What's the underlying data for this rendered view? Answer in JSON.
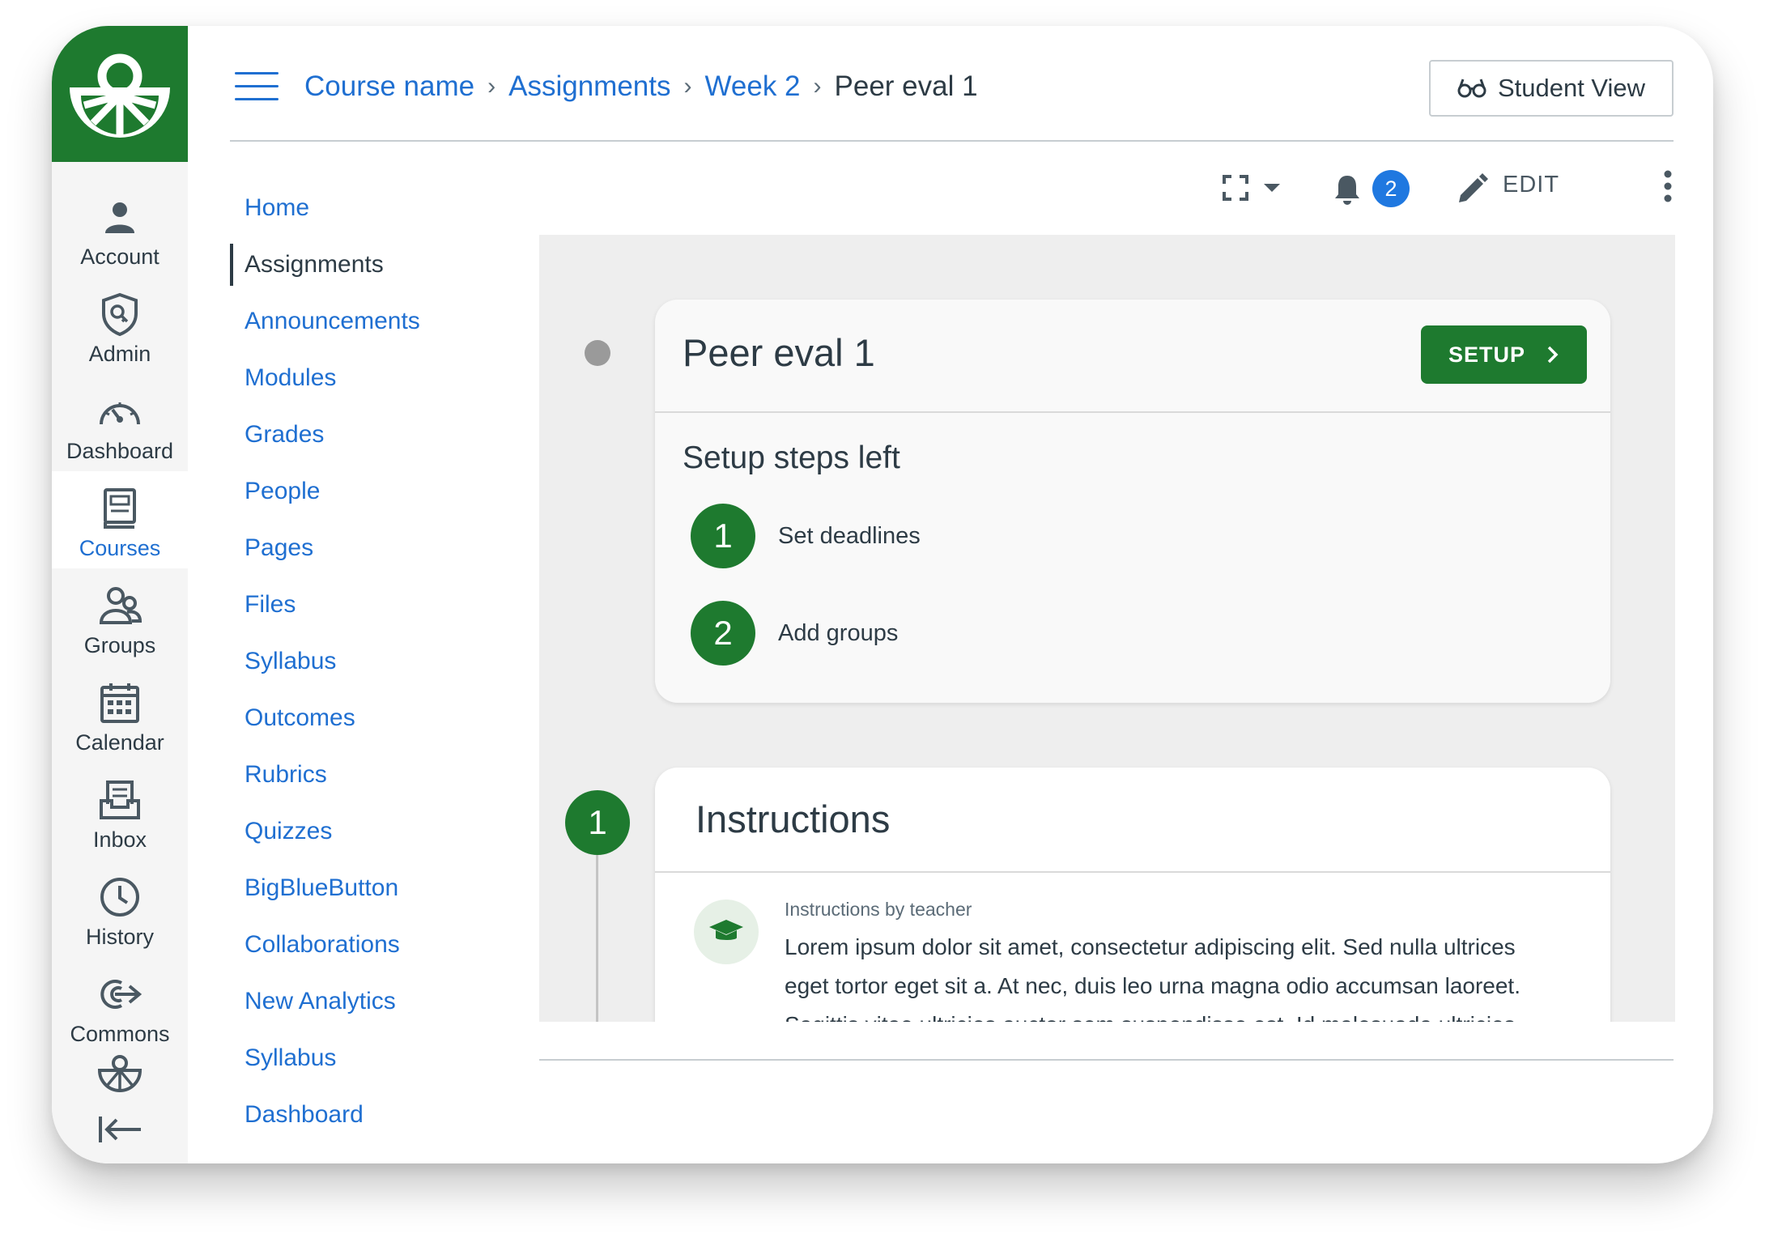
{
  "global_nav": {
    "items": [
      {
        "label": "Account",
        "icon": "account-icon"
      },
      {
        "label": "Admin",
        "icon": "admin-shield-icon"
      },
      {
        "label": "Dashboard",
        "icon": "dashboard-gauge-icon"
      },
      {
        "label": "Courses",
        "icon": "courses-book-icon",
        "active": true
      },
      {
        "label": "Groups",
        "icon": "groups-icon"
      },
      {
        "label": "Calendar",
        "icon": "calendar-icon"
      },
      {
        "label": "Inbox",
        "icon": "inbox-icon"
      },
      {
        "label": "History",
        "icon": "history-clock-icon"
      },
      {
        "label": "Commons",
        "icon": "commons-icon"
      }
    ]
  },
  "header": {
    "breadcrumbs": [
      "Course name",
      "Assignments",
      "Week 2"
    ],
    "current": "Peer eval 1",
    "student_view_label": "Student View"
  },
  "course_nav": {
    "items": [
      {
        "label": "Home"
      },
      {
        "label": "Assignments",
        "active": true
      },
      {
        "label": "Announcements"
      },
      {
        "label": "Modules"
      },
      {
        "label": "Grades"
      },
      {
        "label": "People"
      },
      {
        "label": "Pages"
      },
      {
        "label": "Files"
      },
      {
        "label": "Syllabus"
      },
      {
        "label": "Outcomes"
      },
      {
        "label": "Rubrics"
      },
      {
        "label": "Quizzes"
      },
      {
        "label": "BigBlueButton"
      },
      {
        "label": "Collaborations"
      },
      {
        "label": "New Analytics"
      },
      {
        "label": "Syllabus"
      },
      {
        "label": "Dashboard"
      }
    ]
  },
  "toolbar": {
    "notification_count": "2",
    "edit_label": "EDIT"
  },
  "assignment_card": {
    "title": "Peer eval 1",
    "setup_label": "SETUP",
    "steps_title": "Setup steps left",
    "steps": [
      {
        "num": "1",
        "label": "Set deadlines"
      },
      {
        "num": "2",
        "label": "Add groups"
      }
    ]
  },
  "instructions_card": {
    "step_num": "1",
    "title": "Instructions",
    "by_label": "Instructions by teacher",
    "text": "Lorem ipsum dolor sit amet, consectetur adipiscing elit. Sed nulla ultrices eget tortor eget sit a. At nec, duis leo urna magna odio accumsan laoreet. Sagittis vitae ultricies auctor sem suspendisse est. Id malesuada ultricies"
  },
  "colors": {
    "brand_green": "#1e7a2f",
    "link_blue": "#1f6fd1",
    "badge_blue": "#1f78e0",
    "text": "#2d3b45"
  }
}
